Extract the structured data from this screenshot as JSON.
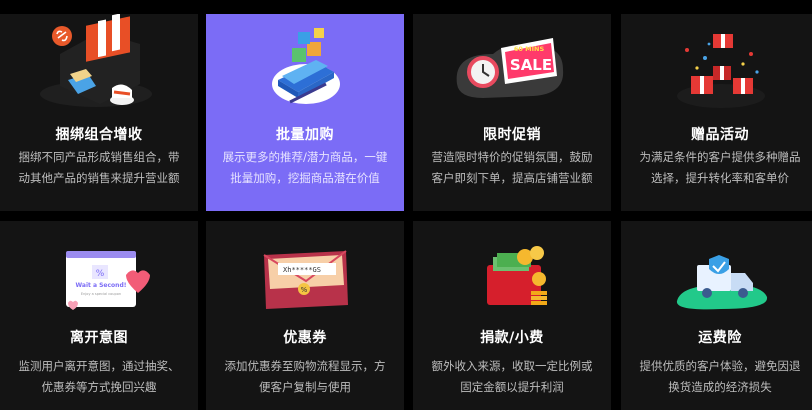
{
  "features": [
    {
      "title": "捆绑组合增收",
      "desc": "捆绑不同产品形成销售组合，带动其他产品的销售来提升营业额",
      "icon": "bundle-products-icon"
    },
    {
      "title": "批量加购",
      "desc": "展示更多的推荐/潜力商品，一键批量加购，挖掘商品潜在价值",
      "icon": "bulk-cart-icon",
      "active": true
    },
    {
      "title": "限时促销",
      "desc": "营造限时特价的促销氛围，鼓励客户即刻下单，提高店铺营业额",
      "icon": "flash-sale-icon",
      "badge_top": "60 MINS",
      "badge_main": "SALE"
    },
    {
      "title": "赠品活动",
      "desc": "为满足条件的客户提供多种赠品选择，提升转化率和客单价",
      "icon": "gift-boxes-icon"
    },
    {
      "title": "离开意图",
      "desc": "监测用户离开意图，通过抽奖、优惠券等方式挽回兴趣",
      "icon": "exit-popup-icon",
      "popup_text": "Wait a Second!",
      "popup_sub": "Enjoy a special coupon",
      "popup_percent": "%"
    },
    {
      "title": "优惠券",
      "desc": "添加优惠券至购物流程显示，方便客户复制与使用",
      "icon": "coupon-icon",
      "coupon_code": "Xh*****GS",
      "coupon_percent": "%"
    },
    {
      "title": "捐款/小费",
      "desc": "额外收入来源，收取一定比例或固定金额以提升利润",
      "icon": "tips-wallet-icon"
    },
    {
      "title": "运费险",
      "desc": "提供优质的客户体验，避免因退换货造成的经济损失",
      "icon": "shipping-insurance-icon"
    }
  ],
  "colors": {
    "page_bg": "#000000",
    "card_bg": "#141414",
    "active_bg": "#7b6cf6"
  }
}
